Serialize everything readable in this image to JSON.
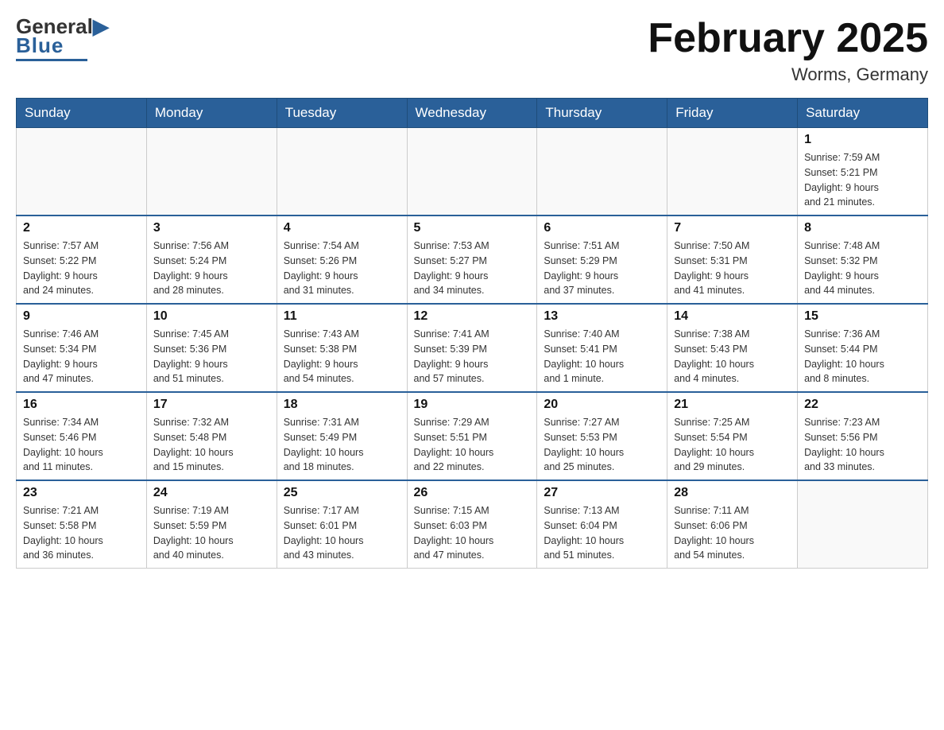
{
  "header": {
    "logo": {
      "text_general": "General",
      "text_blue": "Blue"
    },
    "title": "February 2025",
    "location": "Worms, Germany"
  },
  "weekdays": [
    "Sunday",
    "Monday",
    "Tuesday",
    "Wednesday",
    "Thursday",
    "Friday",
    "Saturday"
  ],
  "weeks": [
    [
      {
        "day": "",
        "info": ""
      },
      {
        "day": "",
        "info": ""
      },
      {
        "day": "",
        "info": ""
      },
      {
        "day": "",
        "info": ""
      },
      {
        "day": "",
        "info": ""
      },
      {
        "day": "",
        "info": ""
      },
      {
        "day": "1",
        "info": "Sunrise: 7:59 AM\nSunset: 5:21 PM\nDaylight: 9 hours\nand 21 minutes."
      }
    ],
    [
      {
        "day": "2",
        "info": "Sunrise: 7:57 AM\nSunset: 5:22 PM\nDaylight: 9 hours\nand 24 minutes."
      },
      {
        "day": "3",
        "info": "Sunrise: 7:56 AM\nSunset: 5:24 PM\nDaylight: 9 hours\nand 28 minutes."
      },
      {
        "day": "4",
        "info": "Sunrise: 7:54 AM\nSunset: 5:26 PM\nDaylight: 9 hours\nand 31 minutes."
      },
      {
        "day": "5",
        "info": "Sunrise: 7:53 AM\nSunset: 5:27 PM\nDaylight: 9 hours\nand 34 minutes."
      },
      {
        "day": "6",
        "info": "Sunrise: 7:51 AM\nSunset: 5:29 PM\nDaylight: 9 hours\nand 37 minutes."
      },
      {
        "day": "7",
        "info": "Sunrise: 7:50 AM\nSunset: 5:31 PM\nDaylight: 9 hours\nand 41 minutes."
      },
      {
        "day": "8",
        "info": "Sunrise: 7:48 AM\nSunset: 5:32 PM\nDaylight: 9 hours\nand 44 minutes."
      }
    ],
    [
      {
        "day": "9",
        "info": "Sunrise: 7:46 AM\nSunset: 5:34 PM\nDaylight: 9 hours\nand 47 minutes."
      },
      {
        "day": "10",
        "info": "Sunrise: 7:45 AM\nSunset: 5:36 PM\nDaylight: 9 hours\nand 51 minutes."
      },
      {
        "day": "11",
        "info": "Sunrise: 7:43 AM\nSunset: 5:38 PM\nDaylight: 9 hours\nand 54 minutes."
      },
      {
        "day": "12",
        "info": "Sunrise: 7:41 AM\nSunset: 5:39 PM\nDaylight: 9 hours\nand 57 minutes."
      },
      {
        "day": "13",
        "info": "Sunrise: 7:40 AM\nSunset: 5:41 PM\nDaylight: 10 hours\nand 1 minute."
      },
      {
        "day": "14",
        "info": "Sunrise: 7:38 AM\nSunset: 5:43 PM\nDaylight: 10 hours\nand 4 minutes."
      },
      {
        "day": "15",
        "info": "Sunrise: 7:36 AM\nSunset: 5:44 PM\nDaylight: 10 hours\nand 8 minutes."
      }
    ],
    [
      {
        "day": "16",
        "info": "Sunrise: 7:34 AM\nSunset: 5:46 PM\nDaylight: 10 hours\nand 11 minutes."
      },
      {
        "day": "17",
        "info": "Sunrise: 7:32 AM\nSunset: 5:48 PM\nDaylight: 10 hours\nand 15 minutes."
      },
      {
        "day": "18",
        "info": "Sunrise: 7:31 AM\nSunset: 5:49 PM\nDaylight: 10 hours\nand 18 minutes."
      },
      {
        "day": "19",
        "info": "Sunrise: 7:29 AM\nSunset: 5:51 PM\nDaylight: 10 hours\nand 22 minutes."
      },
      {
        "day": "20",
        "info": "Sunrise: 7:27 AM\nSunset: 5:53 PM\nDaylight: 10 hours\nand 25 minutes."
      },
      {
        "day": "21",
        "info": "Sunrise: 7:25 AM\nSunset: 5:54 PM\nDaylight: 10 hours\nand 29 minutes."
      },
      {
        "day": "22",
        "info": "Sunrise: 7:23 AM\nSunset: 5:56 PM\nDaylight: 10 hours\nand 33 minutes."
      }
    ],
    [
      {
        "day": "23",
        "info": "Sunrise: 7:21 AM\nSunset: 5:58 PM\nDaylight: 10 hours\nand 36 minutes."
      },
      {
        "day": "24",
        "info": "Sunrise: 7:19 AM\nSunset: 5:59 PM\nDaylight: 10 hours\nand 40 minutes."
      },
      {
        "day": "25",
        "info": "Sunrise: 7:17 AM\nSunset: 6:01 PM\nDaylight: 10 hours\nand 43 minutes."
      },
      {
        "day": "26",
        "info": "Sunrise: 7:15 AM\nSunset: 6:03 PM\nDaylight: 10 hours\nand 47 minutes."
      },
      {
        "day": "27",
        "info": "Sunrise: 7:13 AM\nSunset: 6:04 PM\nDaylight: 10 hours\nand 51 minutes."
      },
      {
        "day": "28",
        "info": "Sunrise: 7:11 AM\nSunset: 6:06 PM\nDaylight: 10 hours\nand 54 minutes."
      },
      {
        "day": "",
        "info": ""
      }
    ]
  ]
}
